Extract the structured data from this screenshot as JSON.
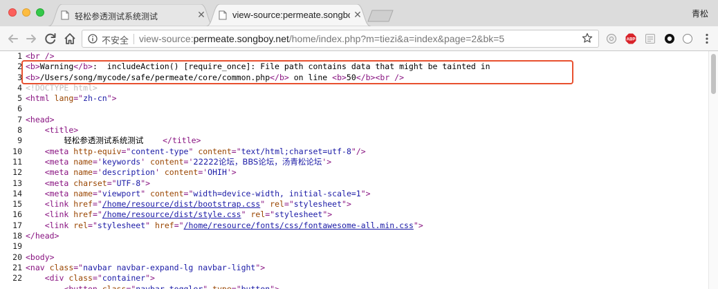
{
  "browser": {
    "tabs": [
      {
        "title": "轻松参透测试系统测试",
        "active": false
      },
      {
        "title": "view-source:permeate.songbo",
        "active": true
      }
    ],
    "profile_name": "青松",
    "address": {
      "security_label": "不安全",
      "scheme": "view-source:",
      "host": "permeate.songboy.net",
      "path": "/home/index.php?m=tiezi&a=index&page=2&bk=5"
    },
    "icons": {
      "back": "arrow-left-icon",
      "forward": "arrow-right-icon",
      "reload": "reload-icon",
      "home": "home-icon",
      "info": "info-icon",
      "bookmark": "star-icon",
      "extensions": [
        "circle-extension-icon",
        "adblock-plus-icon",
        "reader-extension-icon",
        "black-circle-extension-icon",
        "white-circle-extension-icon"
      ],
      "menu": "kebab-menu-icon"
    },
    "colors": {
      "tag": "#881280",
      "attr": "#994500",
      "value": "#1a1aa6",
      "highlight": "#e8502f",
      "adblock": "#d8232a"
    }
  },
  "source": {
    "line_numbers": [
      "1",
      "2",
      "3",
      "4",
      "5",
      "6",
      "7",
      "8",
      "9",
      "10",
      "11",
      "12",
      "13",
      "14",
      "15",
      "16",
      "17",
      "18",
      "19",
      "20",
      "21",
      "22"
    ],
    "lines": [
      [
        {
          "t": "<br />",
          "c": "tag"
        }
      ],
      [
        {
          "t": "<b>",
          "c": "tag"
        },
        {
          "t": "Warning",
          "c": ""
        },
        {
          "t": "</b>",
          "c": "tag"
        },
        {
          "t": ":  includeAction() [require_once]: File path contains data that might be tainted in",
          "c": ""
        }
      ],
      [
        {
          "t": "<b>",
          "c": "tag"
        },
        {
          "t": "/Users/song/mycode/safe/permeate/core/common.php",
          "c": ""
        },
        {
          "t": "</b>",
          "c": "tag"
        },
        {
          "t": " on line ",
          "c": ""
        },
        {
          "t": "<b>",
          "c": "tag"
        },
        {
          "t": "50",
          "c": ""
        },
        {
          "t": "</b>",
          "c": "tag"
        },
        {
          "t": "<br />",
          "c": "tag"
        }
      ],
      [
        {
          "t": "<!DOCTYPE html>",
          "c": "cmt"
        }
      ],
      [
        {
          "t": "<html ",
          "c": "tag"
        },
        {
          "t": "lang",
          "c": "attr"
        },
        {
          "t": "=\"",
          "c": "tag"
        },
        {
          "t": "zh-cn",
          "c": "val"
        },
        {
          "t": "\">",
          "c": "tag"
        }
      ],
      [
        {
          "t": "",
          "c": ""
        }
      ],
      [
        {
          "t": "<head>",
          "c": "tag"
        }
      ],
      [
        {
          "t": "    ",
          "c": ""
        },
        {
          "t": "<title>",
          "c": "tag"
        }
      ],
      [
        {
          "t": "        ",
          "c": ""
        },
        {
          "t": "轻松参透测试系统测试",
          "c": "cjk"
        },
        {
          "t": "    ",
          "c": ""
        },
        {
          "t": "</title>",
          "c": "tag"
        }
      ],
      [
        {
          "t": "    ",
          "c": ""
        },
        {
          "t": "<meta ",
          "c": "tag"
        },
        {
          "t": "http-equiv",
          "c": "attr"
        },
        {
          "t": "=\"",
          "c": "tag"
        },
        {
          "t": "content-type",
          "c": "val"
        },
        {
          "t": "\" ",
          "c": "tag"
        },
        {
          "t": "content",
          "c": "attr"
        },
        {
          "t": "=\"",
          "c": "tag"
        },
        {
          "t": "text/html;charset=utf-8",
          "c": "val"
        },
        {
          "t": "\"/>",
          "c": "tag"
        }
      ],
      [
        {
          "t": "    ",
          "c": ""
        },
        {
          "t": "<meta ",
          "c": "tag"
        },
        {
          "t": "name",
          "c": "attr"
        },
        {
          "t": "='",
          "c": "tag"
        },
        {
          "t": "keywords",
          "c": "val"
        },
        {
          "t": "' ",
          "c": "tag"
        },
        {
          "t": "content",
          "c": "attr"
        },
        {
          "t": "='",
          "c": "tag"
        },
        {
          "t": "22222论坛，BBS论坛，汤青松论坛",
          "c": "val cjk"
        },
        {
          "t": "'>",
          "c": "tag"
        }
      ],
      [
        {
          "t": "    ",
          "c": ""
        },
        {
          "t": "<meta ",
          "c": "tag"
        },
        {
          "t": "name",
          "c": "attr"
        },
        {
          "t": "='",
          "c": "tag"
        },
        {
          "t": "description",
          "c": "val"
        },
        {
          "t": "' ",
          "c": "tag"
        },
        {
          "t": "content",
          "c": "attr"
        },
        {
          "t": "='",
          "c": "tag"
        },
        {
          "t": "OHIH",
          "c": "val"
        },
        {
          "t": "'>",
          "c": "tag"
        }
      ],
      [
        {
          "t": "    ",
          "c": ""
        },
        {
          "t": "<meta ",
          "c": "tag"
        },
        {
          "t": "charset",
          "c": "attr"
        },
        {
          "t": "=\"",
          "c": "tag"
        },
        {
          "t": "UTF-8",
          "c": "val"
        },
        {
          "t": "\">",
          "c": "tag"
        }
      ],
      [
        {
          "t": "    ",
          "c": ""
        },
        {
          "t": "<meta ",
          "c": "tag"
        },
        {
          "t": "name",
          "c": "attr"
        },
        {
          "t": "=\"",
          "c": "tag"
        },
        {
          "t": "viewport",
          "c": "val"
        },
        {
          "t": "\" ",
          "c": "tag"
        },
        {
          "t": "content",
          "c": "attr"
        },
        {
          "t": "=\"",
          "c": "tag"
        },
        {
          "t": "width=device-width, initial-scale=1",
          "c": "val"
        },
        {
          "t": "\">",
          "c": "tag"
        }
      ],
      [
        {
          "t": "    ",
          "c": ""
        },
        {
          "t": "<link ",
          "c": "tag"
        },
        {
          "t": "href",
          "c": "attr"
        },
        {
          "t": "=\"",
          "c": "tag"
        },
        {
          "t": "/home/resource/dist/bootstrap.css",
          "c": "link"
        },
        {
          "t": "\" ",
          "c": "tag"
        },
        {
          "t": "rel",
          "c": "attr"
        },
        {
          "t": "=\"",
          "c": "tag"
        },
        {
          "t": "stylesheet",
          "c": "val"
        },
        {
          "t": "\">",
          "c": "tag"
        }
      ],
      [
        {
          "t": "    ",
          "c": ""
        },
        {
          "t": "<link ",
          "c": "tag"
        },
        {
          "t": "href",
          "c": "attr"
        },
        {
          "t": "=\"",
          "c": "tag"
        },
        {
          "t": "/home/resource/dist/style.css",
          "c": "link"
        },
        {
          "t": "\" ",
          "c": "tag"
        },
        {
          "t": "rel",
          "c": "attr"
        },
        {
          "t": "=\"",
          "c": "tag"
        },
        {
          "t": "stylesheet",
          "c": "val"
        },
        {
          "t": "\">",
          "c": "tag"
        }
      ],
      [
        {
          "t": "    ",
          "c": ""
        },
        {
          "t": "<link ",
          "c": "tag"
        },
        {
          "t": "rel",
          "c": "attr"
        },
        {
          "t": "=\"",
          "c": "tag"
        },
        {
          "t": "stylesheet",
          "c": "val"
        },
        {
          "t": "\" ",
          "c": "tag"
        },
        {
          "t": "href",
          "c": "attr"
        },
        {
          "t": "=\"",
          "c": "tag"
        },
        {
          "t": "/home/resource/fonts/css/fontawesome-all.min.css",
          "c": "link"
        },
        {
          "t": "\">",
          "c": "tag"
        }
      ],
      [
        {
          "t": "</head>",
          "c": "tag"
        }
      ],
      [
        {
          "t": "",
          "c": ""
        }
      ],
      [
        {
          "t": "<body>",
          "c": "tag"
        }
      ],
      [
        {
          "t": "<nav ",
          "c": "tag"
        },
        {
          "t": "class",
          "c": "attr"
        },
        {
          "t": "=\"",
          "c": "tag"
        },
        {
          "t": "navbar navbar-expand-lg navbar-light",
          "c": "val"
        },
        {
          "t": "\">",
          "c": "tag"
        }
      ],
      [
        {
          "t": "    ",
          "c": ""
        },
        {
          "t": "<div ",
          "c": "tag"
        },
        {
          "t": "class",
          "c": "attr"
        },
        {
          "t": "=\"",
          "c": "tag"
        },
        {
          "t": "container",
          "c": "val"
        },
        {
          "t": "\">",
          "c": "tag"
        }
      ],
      [
        {
          "t": "        ",
          "c": ""
        },
        {
          "t": "<button ",
          "c": "tag"
        },
        {
          "t": "class",
          "c": "attr"
        },
        {
          "t": "=\"",
          "c": "tag"
        },
        {
          "t": "navbar-toggler",
          "c": "val"
        },
        {
          "t": "\" ",
          "c": "tag"
        },
        {
          "t": "type",
          "c": "attr"
        },
        {
          "t": "=\"",
          "c": "tag"
        },
        {
          "t": "button",
          "c": "val"
        },
        {
          "t": "\">",
          "c": "tag"
        }
      ]
    ]
  }
}
